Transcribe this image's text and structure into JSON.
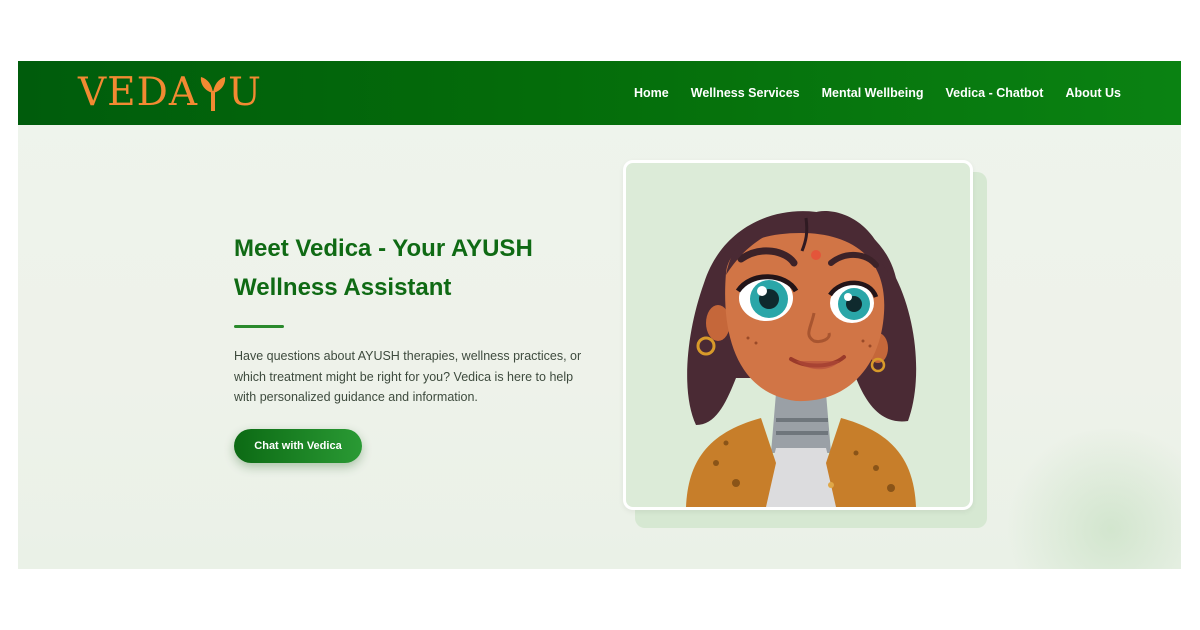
{
  "brand": {
    "logo_text_left": "VEDA",
    "logo_text_right": "U",
    "logo_color": "#f28a32"
  },
  "nav": {
    "items": [
      "Home",
      "Wellness Services",
      "Mental Wellbeing",
      "Vedica - Chatbot",
      "About Us"
    ]
  },
  "hero": {
    "title": "Meet Vedica - Your AYUSH Wellness Assistant",
    "description": "Have questions about AYUSH therapies, wellness practices, or which treatment might be right for you? Vedica is here to help with personalized guidance and information.",
    "cta_label": "Chat with Vedica"
  },
  "avatar": {
    "icon": "vedica-avatar-illustration"
  },
  "colors": {
    "nav_start": "#005c0c",
    "nav_end": "#0a8212",
    "title_green": "#0f6a14",
    "accent_orange": "#f28a32"
  }
}
